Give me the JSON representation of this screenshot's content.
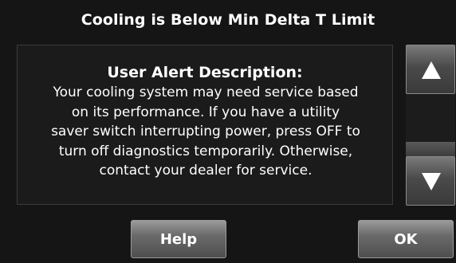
{
  "title": "Cooling is Below Min Delta T Limit",
  "alert": {
    "heading": "User Alert Description:",
    "lines": [
      "Your cooling system may need service based",
      "on its performance. If you have a utility",
      "saver switch interrupting power, press OFF to",
      "turn off diagnostics temporarily. Otherwise,",
      "contact your dealer for service."
    ]
  },
  "scroll": {
    "up_icon": "triangle-up-icon",
    "down_icon": "triangle-down-icon"
  },
  "buttons": {
    "help_label": "Help",
    "ok_label": "OK"
  }
}
